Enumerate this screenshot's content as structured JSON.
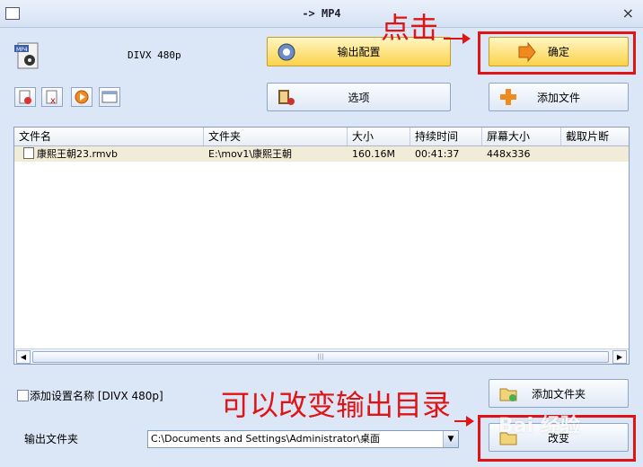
{
  "window": {
    "title": "-> MP4",
    "close": "×"
  },
  "profile": {
    "name": "DIVX 480p"
  },
  "buttons": {
    "output_config": "输出配置",
    "confirm": "确定",
    "options": "选项",
    "add_file": "添加文件",
    "add_folder": "添加文件夹",
    "change": "改变"
  },
  "file_list": {
    "columns": [
      "文件名",
      "文件夹",
      "大小",
      "持续时间",
      "屏幕大小",
      "截取片断"
    ],
    "rows": [
      {
        "name": "康熙王朝23.rmvb",
        "folder": "E:\\mov1\\康熙王朝",
        "size": "160.16M",
        "duration": "00:41:37",
        "screen": "448x336",
        "clip": ""
      }
    ],
    "scroll_left": "◀",
    "scroll_right": "▶",
    "scroll_grip": "|||"
  },
  "options": {
    "add_setting_name_label": "添加设置名称 [DIVX 480p]",
    "output_folder_label": "输出文件夹",
    "output_folder_value": "C:\\Documents and Settings\\Administrator\\桌面",
    "dropdown_arrow": "▼"
  },
  "annotations": {
    "click": "点击",
    "change_output": "可以改变输出目录"
  },
  "colors": {
    "annotation_red": "#e01414",
    "confirm_orange": "#fbd24c"
  }
}
